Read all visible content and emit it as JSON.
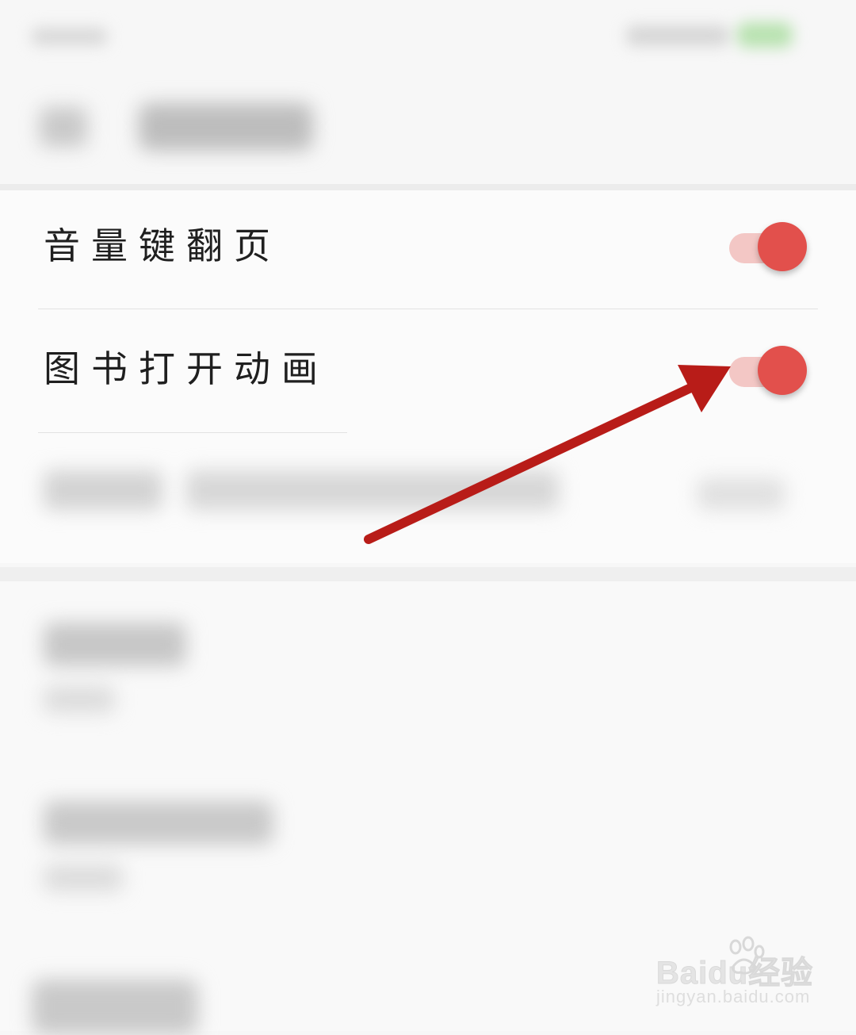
{
  "settings": {
    "rows": [
      {
        "label": "音量键翻页",
        "toggle_on": true
      },
      {
        "label": "图书打开动画",
        "toggle_on": true
      }
    ]
  },
  "annotation": {
    "arrow_color": "#b81c18",
    "points_to": "book-open-animation-toggle"
  },
  "watermark": {
    "logo_text": "Baidu经验",
    "url_text": "jingyan.baidu.com"
  },
  "colors": {
    "toggle_knob": "#e2504c",
    "toggle_track": "#f3c7c5",
    "background": "#f7f7f7"
  }
}
